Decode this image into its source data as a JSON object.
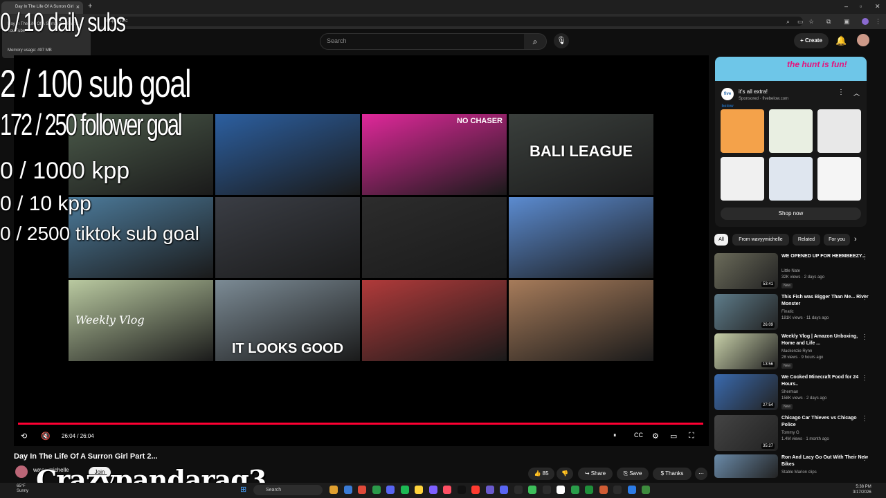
{
  "browser": {
    "tab_title": "Day In The Life Of A Surron Girl",
    "url": "9MqDkJaic",
    "memory_usage": "Memory usage: 497 MB",
    "popup_line1": "Day In The Life Of A Surron Girl Part 2...",
    "popup_line2": "You Tube"
  },
  "youtube": {
    "search_placeholder": "Search",
    "create_label": "Create"
  },
  "overlays": {
    "daily_subs": "0 / 10 daily subs",
    "sub_goal": "2  / 100 sub goal",
    "follower_goal": "172 / 250 follower goal",
    "kpp_1000": "0 / 1000 kpp",
    "kpp_10": "0 / 10 kpp",
    "tiktok_goal": "0 / 2500 tiktok sub goal",
    "watermark": "Crazypandarag3"
  },
  "end_screen": [
    {
      "color": "#4b5a4a",
      "caption": ""
    },
    {
      "color": "#2c5fa0",
      "caption": ""
    },
    {
      "color": "#e0289a",
      "caption": "NO CHASER"
    },
    {
      "color": "#3a3f3c",
      "caption": "BALI LEAGUE"
    },
    {
      "color": "#4c7a9a",
      "caption": ""
    },
    {
      "color": "#3a3d44",
      "caption": ""
    },
    {
      "color": "#2c2c2c",
      "caption": ""
    },
    {
      "color": "#5b8bd0",
      "caption": ""
    },
    {
      "color": "#b9c9a0",
      "caption": "Weekly Vlog"
    },
    {
      "color": "#7b8a94",
      "caption": "IT LOOKS GOOD"
    },
    {
      "color": "#b03a3a",
      "caption": ""
    },
    {
      "color": "#a67b5a",
      "caption": ""
    }
  ],
  "player": {
    "time": "26:04 / 26:04",
    "progress": 1.0
  },
  "video": {
    "title": "Day In The Life Of A Surron Girl Part 2...",
    "channel": "wavyymichelle",
    "join": "Join",
    "likes": "85",
    "share": "Share",
    "save": "Save",
    "thanks": "Thanks"
  },
  "ad": {
    "banner": "the hunt is fun!",
    "logo": "five below",
    "title": "it's all extra!",
    "sponsored": "Sponsored · fivebelow.com",
    "products": [
      "#f4a24a",
      "#e9efe2",
      "#e8e8e8",
      "#f0f0f0",
      "#dfe6ef",
      "#f5f5f5"
    ],
    "shop_now": "Shop now"
  },
  "chips": [
    "All",
    "From wavyymichelle",
    "Related",
    "For you"
  ],
  "recommendations": [
    {
      "title": "WE OPENED UP FOR HEEMBEEZY...",
      "channel": "Little Nate",
      "meta": "32K views · 2 days ago",
      "badge": "New",
      "duration": "53:41",
      "color": "#6b6b5a"
    },
    {
      "title": "This Fish was Bigger Than Me... River Monster",
      "channel": "Finatic",
      "meta": "181K views · 11 days ago",
      "badge": "",
      "duration": "26:09",
      "color": "#5e7c8a"
    },
    {
      "title": "Weekly Vlog | Amazon Unboxing, Home and Life ...",
      "channel": "Mackenzie Rynn",
      "meta": "28 views · 9 hours ago",
      "badge": "New",
      "duration": "13:56",
      "color": "#c7cfa8"
    },
    {
      "title": "We Cooked Minecraft Food for 24 Hours..",
      "channel": "Sherman",
      "meta": "158K views · 2 days ago",
      "badge": "New",
      "duration": "27:54",
      "color": "#3a6aae"
    },
    {
      "title": "Chicago Car Thieves vs Chicago Police",
      "channel": "Tommy G",
      "meta": "1.4M views · 1 month ago",
      "badge": "",
      "duration": "35:27",
      "color": "#444"
    },
    {
      "title": "Ron And Lacy Go Out With Their New Bikes",
      "channel": "Stable Marion clips",
      "meta": "",
      "badge": "",
      "duration": "",
      "color": "#6a8aa8"
    }
  ],
  "taskbar": {
    "temp": "65°F",
    "weather": "Sunny",
    "search": "Search",
    "time": "5:38 PM",
    "date": "3/17/2026"
  }
}
